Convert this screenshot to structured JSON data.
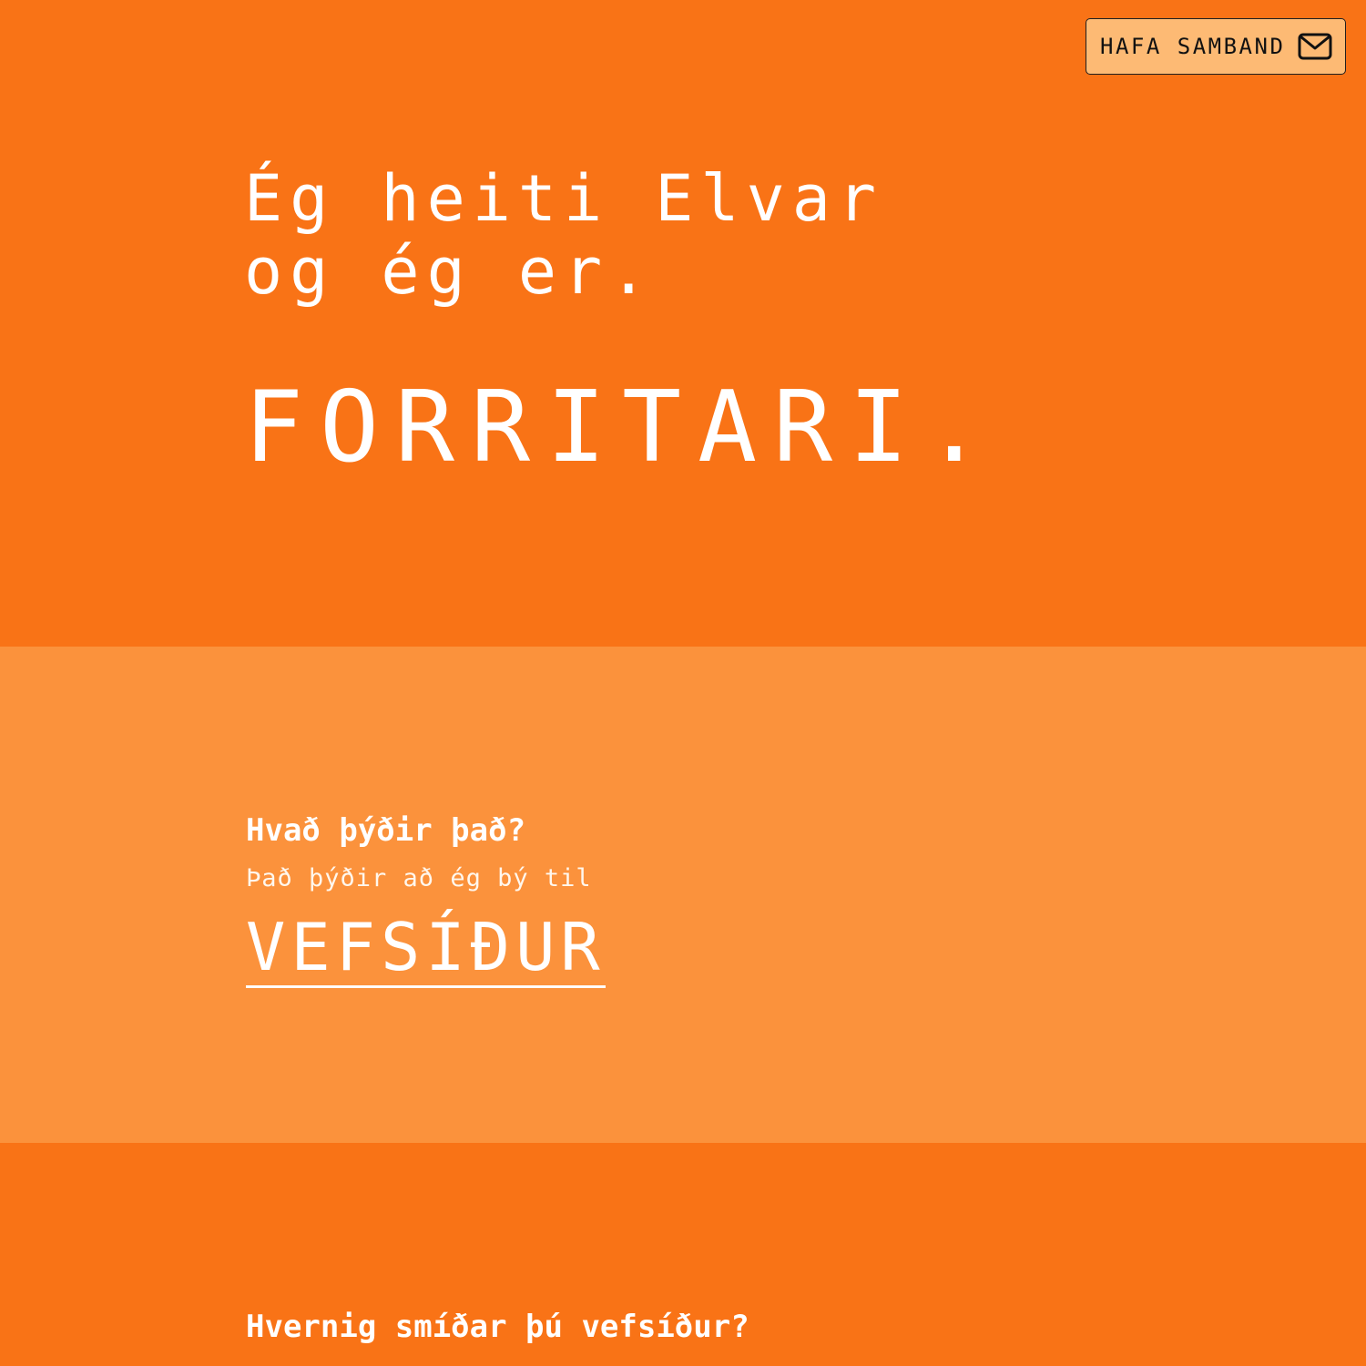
{
  "header": {
    "contact_button": {
      "label": "HAFA SAMBAND",
      "icon": "mail-icon"
    }
  },
  "hero": {
    "intro_line_1": "Ég heiti Elvar",
    "intro_line_2": "og ég er.",
    "role": "FORRITARI."
  },
  "section_what": {
    "question": "Hvað þýðir það?",
    "answer": "Það þýðir að ég bý til",
    "highlight_link": "VEFSÍÐUR"
  },
  "section_how": {
    "question": "Hvernig smíðar þú vefsíður?"
  },
  "colors": {
    "hero_background": "#f97316",
    "section_background": "#fb923c",
    "button_background": "#fdba74",
    "text": "#ffffff"
  }
}
